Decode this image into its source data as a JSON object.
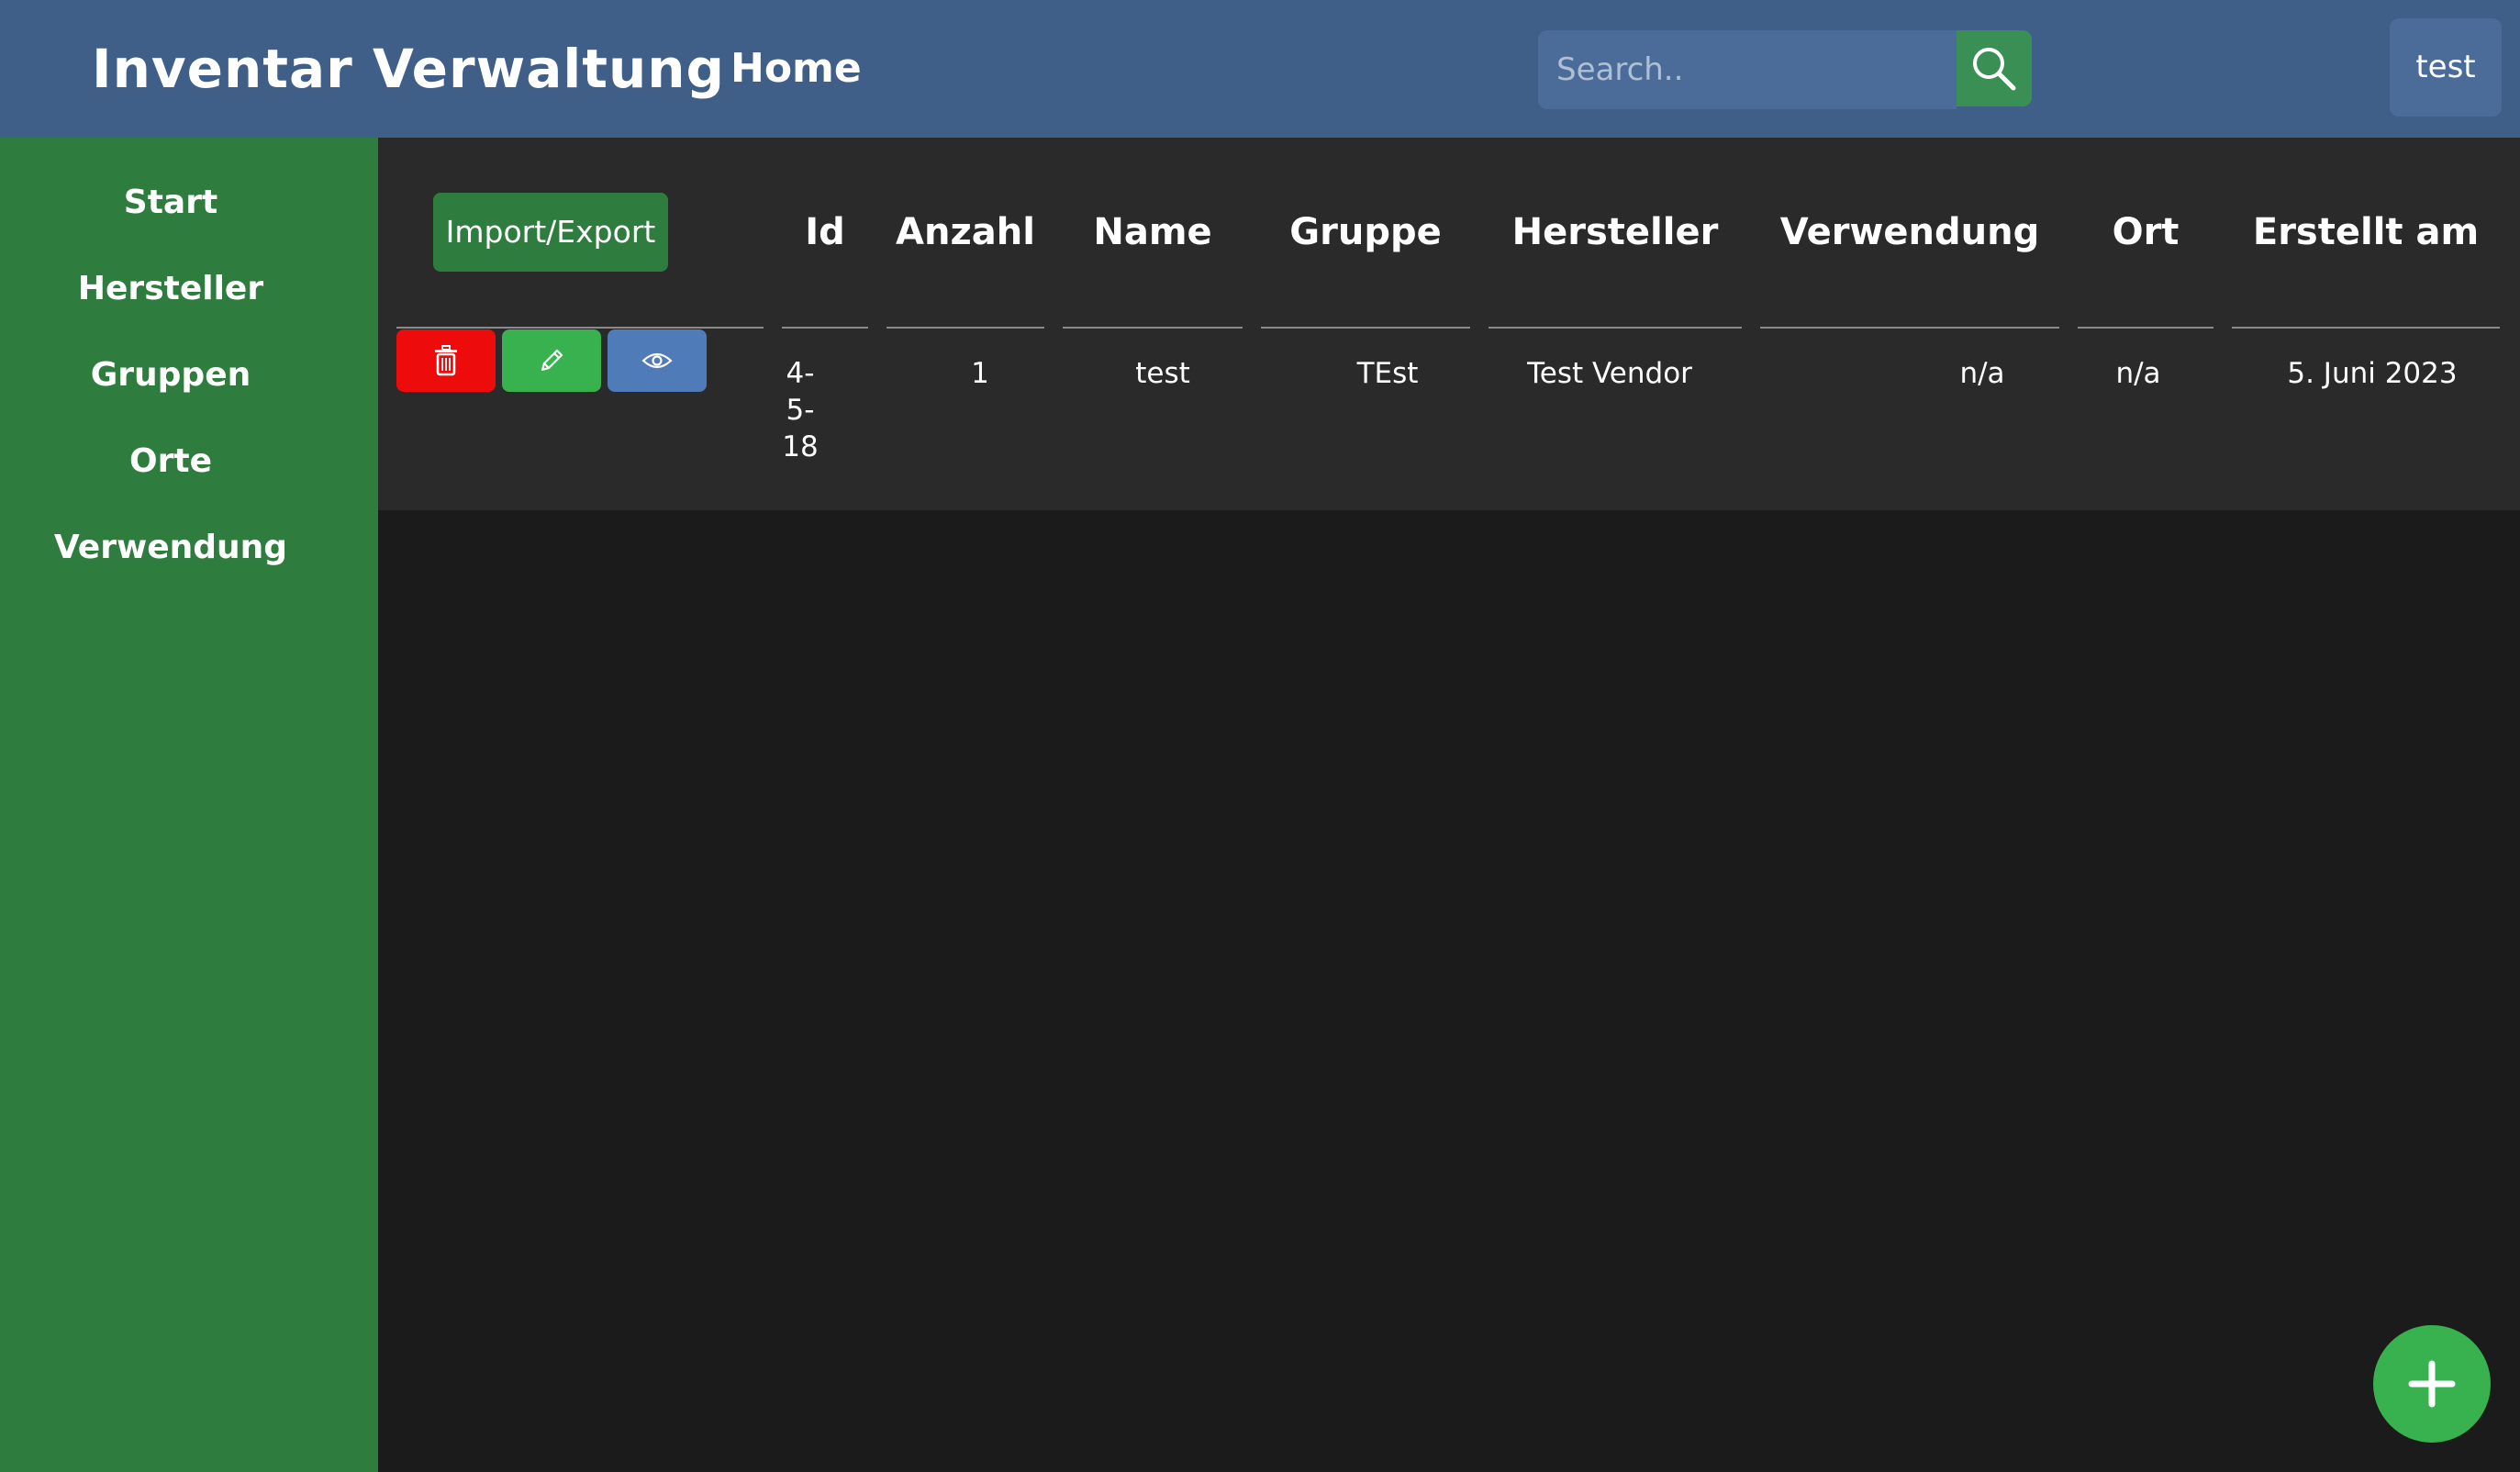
{
  "header": {
    "brand": "Inventar Verwaltung",
    "home_label": "Home",
    "search_placeholder": "Search..",
    "user_label": "test"
  },
  "sidebar": {
    "items": [
      {
        "label": "Start"
      },
      {
        "label": "Hersteller"
      },
      {
        "label": "Gruppen"
      },
      {
        "label": "Orte"
      },
      {
        "label": "Verwendung"
      }
    ]
  },
  "table": {
    "import_export_label": "Import/Export",
    "columns": [
      "Id",
      "Anzahl",
      "Name",
      "Gruppe",
      "Hersteller",
      "Verwendung",
      "Ort",
      "Erstellt am"
    ],
    "rows": [
      {
        "id_lines": [
          "4-",
          "5-",
          "18"
        ],
        "anzahl": "1",
        "name": "test",
        "gruppe": "TEst",
        "hersteller": "Test Vendor",
        "verwendung": "n/a",
        "ort": "n/a",
        "erstellt_am": "5. Juni 2023"
      }
    ],
    "row_actions": [
      "trash-icon",
      "pencil-icon",
      "eye-icon"
    ]
  },
  "colors": {
    "header_bg": "#3f5e88",
    "sidebar_bg": "#2e7d3e",
    "panel_bg": "#2a2a2a",
    "page_bg": "#1b1b1b",
    "delete": "#ee0b0b",
    "edit": "#38b14f",
    "view": "#4f7bb8",
    "search_button": "#3a8f55",
    "fab": "#38b14f"
  },
  "fab_icon": "plus-icon"
}
